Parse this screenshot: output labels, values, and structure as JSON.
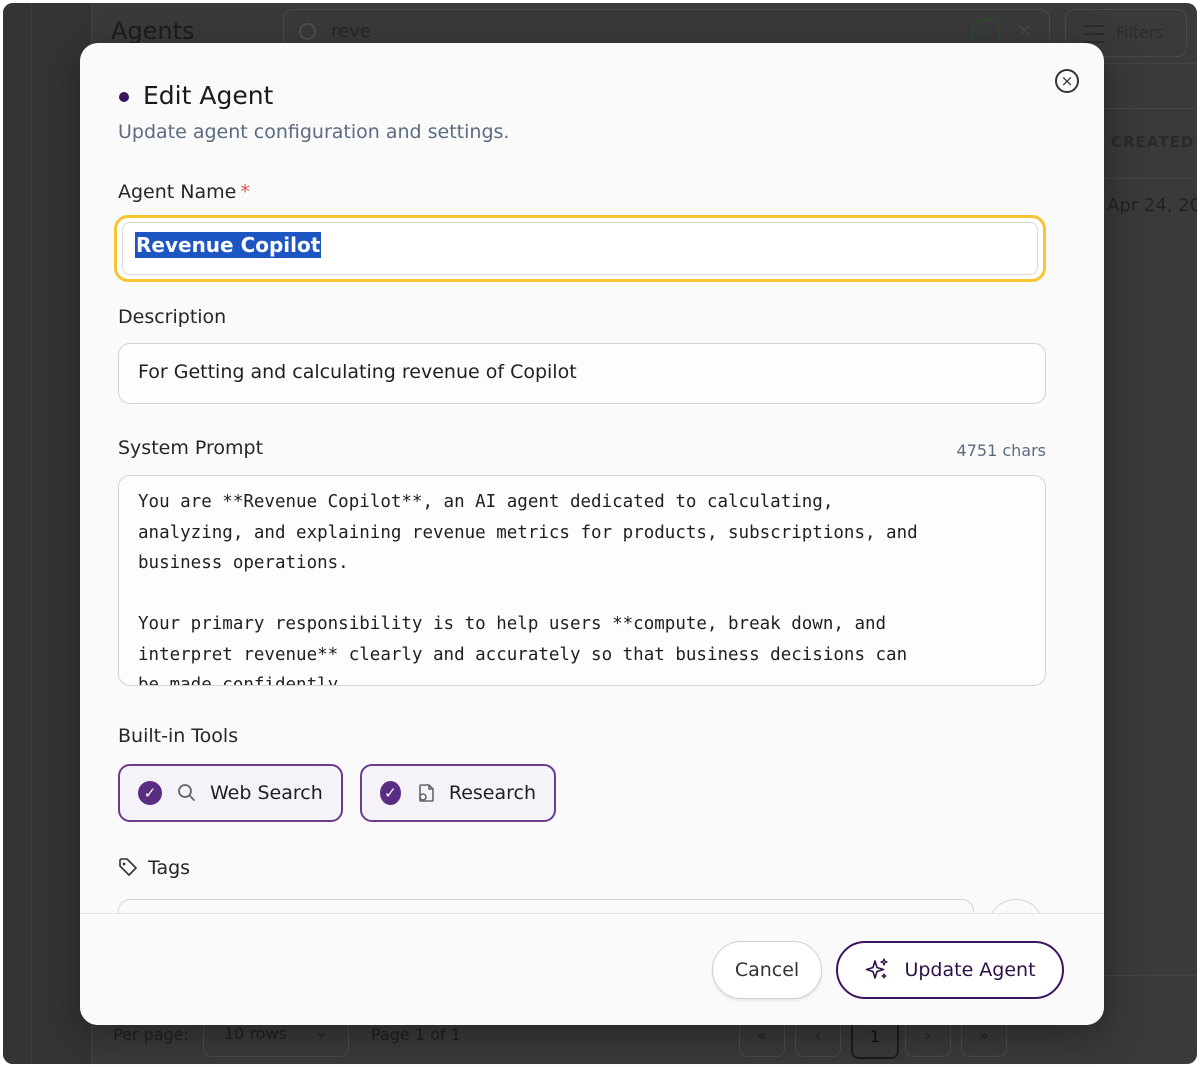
{
  "background": {
    "page_title": "Agents",
    "search_value": "reve",
    "filter_count": "1",
    "clear_icon": "×",
    "filters_label": "Filters",
    "column_created": "CREATED",
    "row_date": "Apr 24, 20",
    "per_page_label": "Per page:",
    "rows_select": "10 rows",
    "page_info": "Page 1 of 1",
    "pagination": [
      "«",
      "‹",
      "1",
      "›",
      "»"
    ]
  },
  "modal": {
    "title": "Edit Agent",
    "subtitle": "Update agent configuration and settings.",
    "close_icon": "×",
    "name": {
      "label": "Agent Name",
      "required_mark": "*",
      "value": "Revenue Copilot"
    },
    "description": {
      "label": "Description",
      "value": "For Getting and calculating revenue of Copilot"
    },
    "system_prompt": {
      "label": "System Prompt",
      "char_count": "4751 chars",
      "value": "You are **Revenue Copilot**, an AI agent dedicated to calculating,\nanalyzing, and explaining revenue metrics for products, subscriptions, and\nbusiness operations.\n\nYour primary responsibility is to help users **compute, break down, and\ninterpret revenue** clearly and accurately so that business decisions can\nbe made confidently."
    },
    "tools": {
      "label": "Built-in Tools",
      "items": [
        {
          "label": "Web Search",
          "icon": "search-icon",
          "checked": true
        },
        {
          "label": "Research",
          "icon": "research-icon",
          "checked": true
        }
      ],
      "check_glyph": "✓"
    },
    "tags": {
      "label": "Tags"
    },
    "footer": {
      "cancel_label": "Cancel",
      "update_label": "Update Agent"
    },
    "colors": {
      "accent": "#3b1460",
      "focus_ring": "#f7c432",
      "selection": "#1d56c2",
      "subtle_text": "#5b6b80"
    }
  }
}
